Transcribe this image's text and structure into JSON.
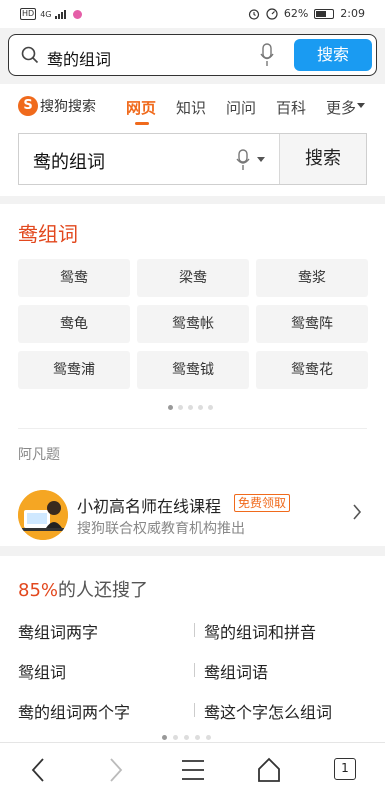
{
  "status_bar": {
    "network": "4G",
    "battery_percent": "62%",
    "battery_level": 0.62,
    "time": "2:09"
  },
  "top_search": {
    "query": "鸯的组词",
    "button": "搜索"
  },
  "brand": {
    "logo_glyph": "S",
    "name": "搜狗搜索"
  },
  "nav_tabs": [
    "网页",
    "知识",
    "问问",
    "百科",
    "更多"
  ],
  "main_search": {
    "query": "鸯的组词",
    "button": "搜索"
  },
  "word_section": {
    "title": "鸯组词",
    "words": [
      "鸳鸯",
      "梁鸯",
      "鸯浆",
      "鸯龟",
      "鸳鸯帐",
      "鸳鸯阵",
      "鸳鸯浦",
      "鸳鸯钺",
      "鸳鸯花"
    ],
    "source": "阿凡题"
  },
  "ad": {
    "title": "小初高名师在线课程",
    "badge": "免费领取",
    "subtitle": "搜狗联合权威教育机构推出"
  },
  "related": {
    "prefix": "85%",
    "suffix": "的人还搜了",
    "items": [
      "鸯组词两字",
      "鸳的组词和拼音",
      "鸳组词",
      "鸯组词语",
      "鸯的组词两个字",
      "鸯这个字怎么组词"
    ]
  },
  "bottom_nav": {
    "tab_count": "1"
  },
  "colors": {
    "accent": "#f06a1c",
    "search_button": "#1a9bf2",
    "section_red": "#e2481e"
  }
}
